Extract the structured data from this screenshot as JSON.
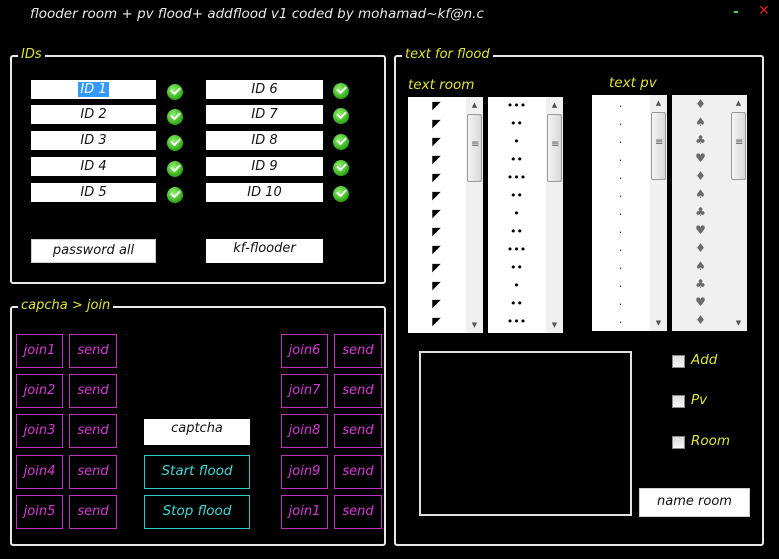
{
  "window": {
    "title": "flooder room + pv flood+ addflood v1 coded by mohamad~kf@n.c",
    "minimize_icon": "minimize-icon",
    "close_icon": "close-icon"
  },
  "ids_group": {
    "legend": "IDs",
    "fields": [
      {
        "value": "ID 1",
        "status": "check-icon",
        "selected": true
      },
      {
        "value": "ID 2",
        "status": "check-icon"
      },
      {
        "value": "ID 3",
        "status": "check-icon"
      },
      {
        "value": "ID 4",
        "status": "check-icon"
      },
      {
        "value": "ID 5",
        "status": "check-icon"
      },
      {
        "value": "ID 6",
        "status": "check-icon"
      },
      {
        "value": "ID 7",
        "status": "check-icon"
      },
      {
        "value": "ID 8",
        "status": "check-icon"
      },
      {
        "value": "ID 9",
        "status": "check-icon"
      },
      {
        "value": "ID 10",
        "status": "check-icon"
      }
    ],
    "password_all_label": "password all",
    "kf_flooder_value": "kf-flooder"
  },
  "captcha_group": {
    "legend": "capcha > join",
    "join_buttons": [
      "join1",
      "join2",
      "join3",
      "join4",
      "join5",
      "join6",
      "join7",
      "join8",
      "join9",
      "join1"
    ],
    "send_label": "send",
    "captcha_value": "captcha",
    "start_label": "Start flood",
    "stop_label": "Stop flood"
  },
  "flood_group": {
    "legend": "text for flood",
    "text_room_label": "text room",
    "text_pv_label": "text pv",
    "room_list_1": [
      "◤",
      "◤",
      "◤",
      "◤",
      "◤",
      "◤",
      "◤",
      "◤",
      "◤",
      "◤",
      "◤",
      "◤",
      "◤"
    ],
    "room_list_2": [
      "•••",
      "••",
      "•",
      "••",
      "•••",
      "••",
      "•",
      "••",
      "•••",
      "••",
      "•",
      "••",
      "•••"
    ],
    "pv_list_1": [
      ".",
      ".",
      ".",
      ".",
      ".",
      ".",
      ".",
      ".",
      ".",
      ".",
      ".",
      ".",
      "."
    ],
    "pv_list_2": [
      "♦",
      "♠",
      "♣",
      "♥",
      "♦",
      "♠",
      "♣",
      "♥",
      "♦",
      "♠",
      "♣",
      "♥",
      "♦"
    ],
    "checkboxes": [
      {
        "label": "Add",
        "checked": false
      },
      {
        "label": "Pv",
        "checked": false
      },
      {
        "label": "Room",
        "checked": false
      }
    ],
    "name_room_label": "name room"
  }
}
